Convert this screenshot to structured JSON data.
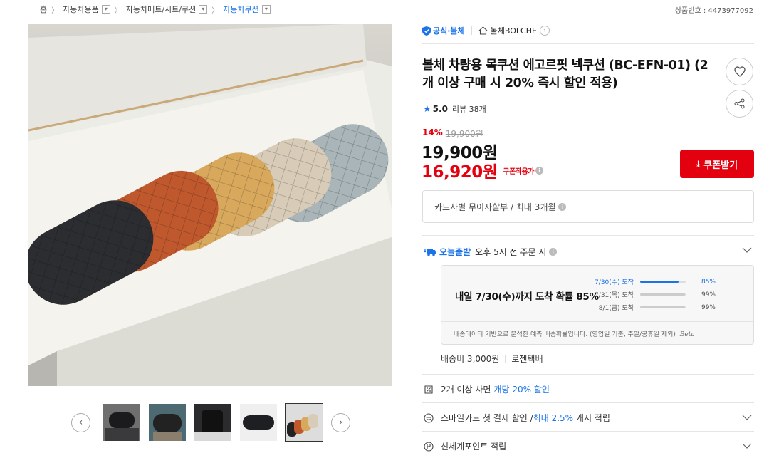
{
  "breadcrumb": {
    "home": "홈",
    "cat1": "자동차용품",
    "cat2": "자동차매트/시트/쿠션",
    "cat3": "자동차쿠션"
  },
  "product_no": "상품번호 : 4473977092",
  "brand": {
    "official": "공식·볼체",
    "store": "볼체BOLCHE"
  },
  "title": "볼체 차량용 목쿠션 에고르핏 넥쿠션 (BC-EFN-01) (2개 이상 구매 시 20% 즉시 할인 적용)",
  "rating": {
    "score": "5.0",
    "review": "리뷰 38개"
  },
  "price": {
    "discount_pct": "14%",
    "original": "19,900원",
    "price": "19,900원",
    "coupon_price": "16,920원",
    "coupon_applied": "쿠폰적용가"
  },
  "coupon_button": "쿠폰받기",
  "card_installment": "카드사별 무이자할부 / 최대 3개월",
  "shipping": {
    "today_label": "오늘출발",
    "cutoff": "오후 5시 전 주문 시",
    "main": "내일 7/30(수)까지 도착 확률 85%",
    "rows": [
      {
        "label": "7/30(수) 도착",
        "value": "85%",
        "pct": 85
      },
      {
        "label": "7/31(목) 도착",
        "value": "99%",
        "pct": 99
      },
      {
        "label": "8/1(금) 도착",
        "value": "99%",
        "pct": 99
      }
    ],
    "note": "배송데이터 기반으로 분석한 예측 배송확률입니다. (영업일 기준, 주말/공휴일 제외)",
    "beta": "Beta",
    "fee": "배송비 3,000원",
    "carrier": "로젠택배"
  },
  "benefits": {
    "multi_prefix": "2개 이상 사면",
    "multi_highlight": "개당 20% 할인",
    "smile_prefix": "스마일카드 첫 결제 할인 / ",
    "smile_highlight": "최대 2.5%",
    "smile_suffix": " 캐시 적립",
    "point": "신세계포인트 적립"
  },
  "colors": {
    "accent_blue": "#1a73e8",
    "accent_red": "#e3000f"
  },
  "icons": [
    "shield-icon",
    "home-icon",
    "heart-icon",
    "share-icon",
    "star-icon",
    "truck-icon",
    "info-icon",
    "chevron-down-icon",
    "coupon-icon",
    "smile-icon",
    "point-icon",
    "download-icon"
  ]
}
